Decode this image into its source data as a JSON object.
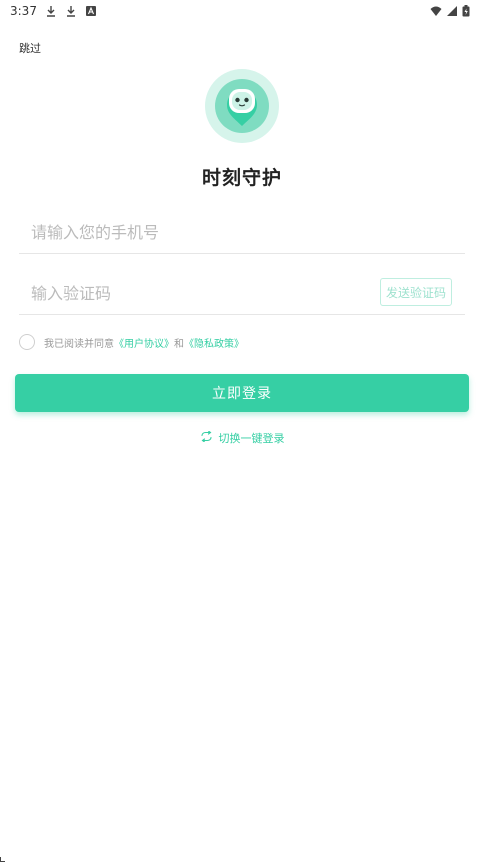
{
  "status_bar": {
    "time": "3:37",
    "left_icons": [
      "download-icon",
      "download-icon",
      "a-icon"
    ],
    "right_icons": [
      "wifi-icon",
      "signal-icon",
      "battery-icon"
    ]
  },
  "skip_label": "跳过",
  "app_title": "时刻守护",
  "phone": {
    "placeholder": "请输入您的手机号",
    "value": ""
  },
  "code": {
    "placeholder": "输入验证码",
    "value": "",
    "send_label": "发送验证码"
  },
  "agreement": {
    "prefix": "我已阅读并同意",
    "user_agreement": "《用户协议》",
    "and": "和",
    "privacy_policy": "《隐私政策》",
    "checked": false
  },
  "login_label": "立即登录",
  "switch_label": "切换一键登录",
  "colors": {
    "accent": "#36cfa4",
    "accent_light": "#bfeee0",
    "placeholder": "#bbbbbb"
  }
}
